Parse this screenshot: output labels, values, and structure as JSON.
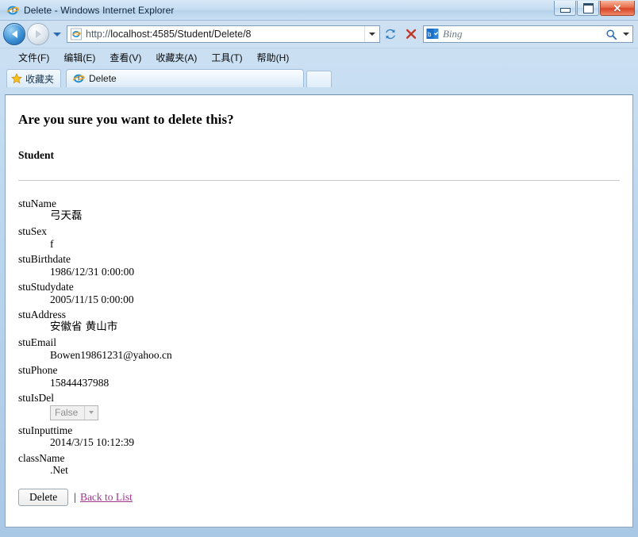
{
  "window": {
    "title": "Delete - Windows Internet Explorer",
    "title_icon": "ie-logo-icon",
    "controls": {
      "minimize": "minimize-button",
      "maximize": "maximize-button",
      "close": "close-button"
    }
  },
  "navbar": {
    "back": "back-button",
    "forward": "forward-button",
    "recent_pages": "recent-pages-chevron",
    "address": {
      "icon": "ie-page-icon",
      "scheme": "http://",
      "host_path": "localhost:4585/Student/Delete/8",
      "value": "http://localhost:4585/Student/Delete/8",
      "dropdown": "address-history-chevron"
    },
    "refresh": "refresh-button",
    "stop": "stop-button",
    "search": {
      "provider_icon": "bing-icon",
      "placeholder": "Bing",
      "go": "search-go-icon",
      "dropdown": "search-provider-chevron"
    }
  },
  "menubar": {
    "items": [
      {
        "label": "文件(F)",
        "name": "menu-file"
      },
      {
        "label": "编辑(E)",
        "name": "menu-edit"
      },
      {
        "label": "查看(V)",
        "name": "menu-view"
      },
      {
        "label": "收藏夹(A)",
        "name": "menu-favorites"
      },
      {
        "label": "工具(T)",
        "name": "menu-tools"
      },
      {
        "label": "帮助(H)",
        "name": "menu-help"
      }
    ]
  },
  "favorites_bar": {
    "icon": "star-icon",
    "label": "收藏夹"
  },
  "tabs": {
    "active": {
      "label": "Delete",
      "icon": "ie-page-icon"
    },
    "new_tab": "new-tab-button"
  },
  "page": {
    "question": "Are you sure you want to delete this?",
    "entity": "Student",
    "fields": [
      {
        "term": "stuName",
        "value": "弓天磊",
        "cjk": true,
        "type": "text"
      },
      {
        "term": "stuSex",
        "value": "f",
        "cjk": false,
        "type": "text"
      },
      {
        "term": "stuBirthdate",
        "value": "1986/12/31 0:00:00",
        "cjk": false,
        "type": "text"
      },
      {
        "term": "stuStudydate",
        "value": "2005/11/15 0:00:00",
        "cjk": false,
        "type": "text"
      },
      {
        "term": "stuAddress",
        "value": "安徽省 黄山市",
        "cjk": true,
        "type": "text"
      },
      {
        "term": "stuEmail",
        "value": "Bowen19861231@yahoo.cn",
        "cjk": false,
        "type": "text"
      },
      {
        "term": "stuPhone",
        "value": "15844437988",
        "cjk": false,
        "type": "text"
      },
      {
        "term": "stuIsDel",
        "value": "False",
        "cjk": false,
        "type": "select"
      },
      {
        "term": "stuInputtime",
        "value": "2014/3/15 10:12:39",
        "cjk": false,
        "type": "text"
      },
      {
        "term": "className",
        "value": ".Net",
        "cjk": false,
        "type": "text"
      }
    ],
    "actions": {
      "delete_label": "Delete",
      "separator": "|",
      "back_label": "Back to List"
    }
  },
  "colors": {
    "link": "#a0358f",
    "close_button": "#d8452a",
    "accent_blue": "#2b6cb0"
  }
}
